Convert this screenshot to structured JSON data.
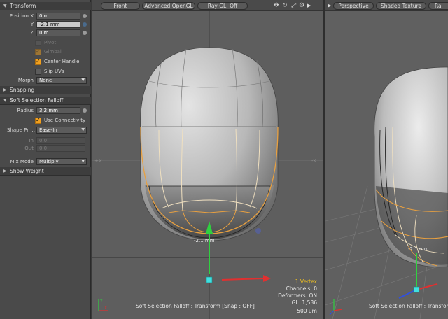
{
  "panel": {
    "transform_section": "Transform",
    "position_x_label": "Position X",
    "position_x": "0 m",
    "y_label": "Y",
    "position_y": "-2.1 mm",
    "z_label": "Z",
    "position_z": "0 m",
    "pivot_label": "Pivot",
    "gimbal_label": "Gimbal",
    "center_handle_label": "Center Handle",
    "slip_uvs_label": "Slip UVs",
    "morph_label": "Morph",
    "morph_value": "None",
    "snapping_section": "Snapping",
    "soft_selection_section": "Soft Selection Falloff",
    "radius_label": "Radius",
    "radius_value": "3.2 mm",
    "use_connectivity_label": "Use Connectivity",
    "shape_preset_label": "Shape Pr ...",
    "shape_preset_value": "Ease-In",
    "in_label": "In",
    "in_value": "0.0",
    "out_label": "Out",
    "out_value": "0.0",
    "mix_mode_label": "Mix Mode",
    "mix_mode_value": "Multiply",
    "show_weight_section": "Show Weight"
  },
  "viewport_front": {
    "view_tab": "Front",
    "shading_tab": "Advanced OpenGL",
    "raygl_tab": "Ray GL: Off",
    "handle_value": "-2.1 mm",
    "info_vertex": "1 Vertex",
    "info_channels": "Channels: 0",
    "info_deformers": "Deformers: ON",
    "info_gl": "GL: 1,536",
    "info_scale": "500 um",
    "status_text": "Soft Selection Falloff : Transform  [Snap : OFF]"
  },
  "viewport_perspective": {
    "view_tab": "Perspective",
    "shading_tab": "Shaded Texture",
    "raygl_tab": "Ra",
    "handle_value": "-2.1 mm",
    "status_text": "Soft Selection Falloff : Transfor"
  },
  "colors": {
    "panel_bg": "#4a4a4a",
    "viewport_bg": "#5e5e5e",
    "accent_orange": "#f0a020",
    "selection_edge": "#e8a040",
    "x_axis": "#e03030",
    "y_axis": "#30d040",
    "handle_cyan": "#40e0e0"
  },
  "icons": [
    "move-icon",
    "rotate-icon",
    "maximize-icon",
    "gear-icon",
    "expand-arrow-icon",
    "axis-gizmo-icon",
    "lock-dot-icon"
  ]
}
